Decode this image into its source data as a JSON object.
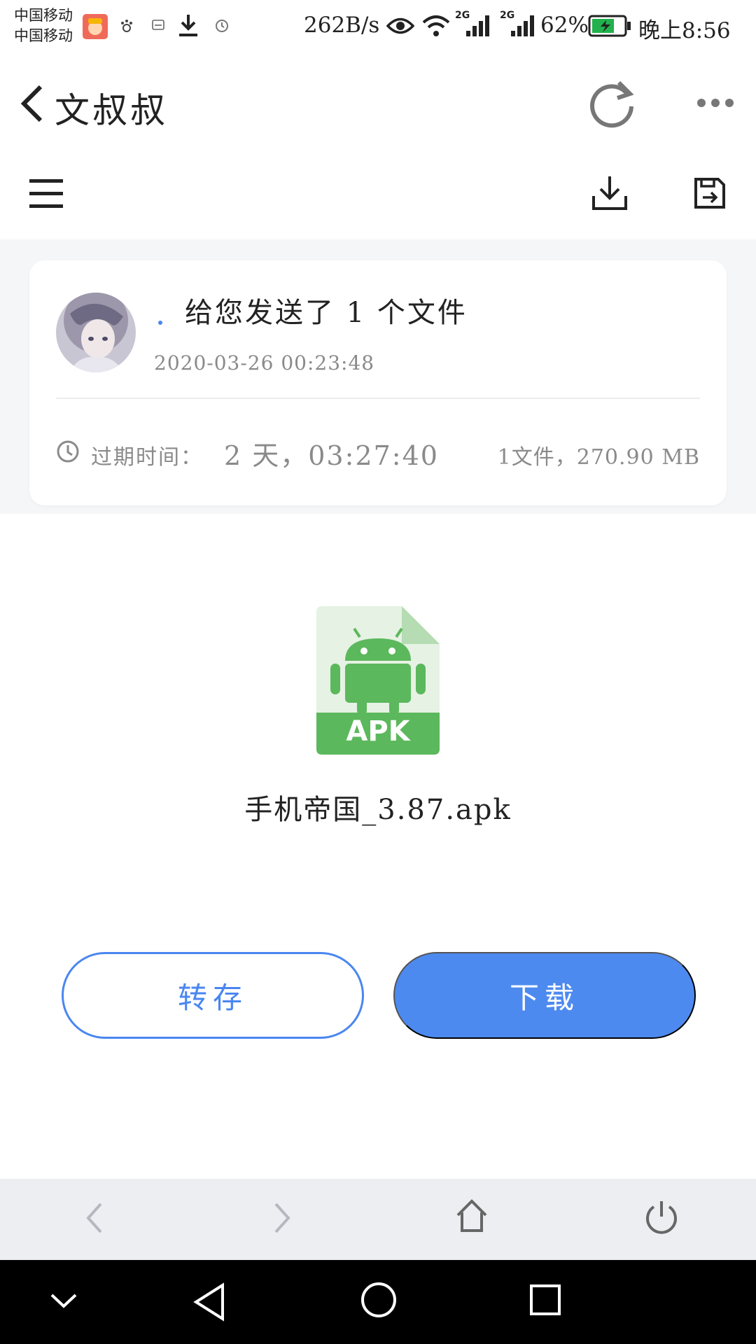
{
  "status_bar": {
    "carrier_1": "中国移动",
    "carrier_2": "中国移动",
    "net_speed": "262B/s",
    "signal_1_type": "2G",
    "signal_2_type": "2G",
    "battery": "62%",
    "time": "晚上8:56",
    "icons": [
      "app-avatar-icon",
      "paw-icon",
      "message-icon",
      "download-icon",
      "alarm-icon",
      "eye-icon",
      "wifi-icon",
      "signal-icon",
      "signal-icon",
      "battery-icon"
    ]
  },
  "header": {
    "title": "文叔叔",
    "icons": [
      "back-icon",
      "refresh-icon",
      "more-icon"
    ]
  },
  "toolbar": {
    "icons": [
      "menu-icon",
      "download-icon",
      "save-to-icon"
    ]
  },
  "card": {
    "sent_message": "给您发送了 1 个文件",
    "sent_time": "2020-03-26 00:23:48",
    "expire_label": "过期时间：",
    "expire_value": "2 天，03:27:40",
    "file_summary": "1文件，270.90 MB"
  },
  "file": {
    "icon_label": "APK",
    "name": "手机帝国_3.87.apk"
  },
  "actions": {
    "save_label": "转存",
    "download_label": "下载"
  },
  "browser_bar": {
    "icons": [
      "back-arrow-icon",
      "forward-arrow-icon",
      "home-icon",
      "power-icon"
    ]
  },
  "system_nav": {
    "icons": [
      "collapse-icon",
      "back-triangle-icon",
      "home-circle-icon",
      "recents-square-icon"
    ]
  },
  "colors": {
    "accent": "#4d8af0",
    "android_green": "#5cb85c"
  }
}
